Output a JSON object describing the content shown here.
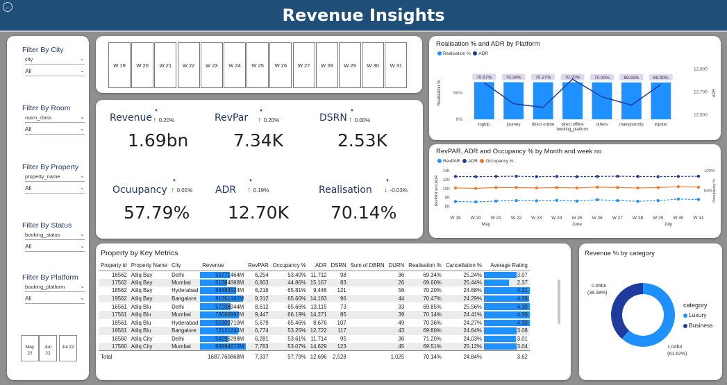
{
  "header": {
    "title": "Revenue Insights"
  },
  "filters": [
    {
      "title": "Filter By City",
      "field": "city",
      "value": "All"
    },
    {
      "title": "Filter By Room",
      "field": "room_class",
      "value": "All"
    },
    {
      "title": "Filter By Property",
      "field": "property_name",
      "value": "All"
    },
    {
      "title": "Filter By Status",
      "field": "booking_status",
      "value": "All"
    },
    {
      "title": "Filter By Platform",
      "field": "booking_platform",
      "value": "All"
    }
  ],
  "months": [
    {
      "line1": "May",
      "line2": "22"
    },
    {
      "line1": "Jun",
      "line2": "22"
    },
    {
      "line1": "Jul 22",
      "line2": ""
    }
  ],
  "weeks": [
    "W 19",
    "W 20",
    "W 21",
    "W 22",
    "W 23",
    "W 24",
    "W 25",
    "W 26",
    "W 27",
    "W 28",
    "W 29",
    "W 30",
    "W 31"
  ],
  "kpis": [
    {
      "name": "Revenue",
      "value": "1.69bn",
      "delta": "0.20%",
      "dir": "up"
    },
    {
      "name": "RevPar",
      "value": "7.34K",
      "delta": "0.20%",
      "dir": "up"
    },
    {
      "name": "DSRN",
      "value": "2.53K",
      "delta": "0.00%",
      "dir": "up"
    },
    {
      "name": "Ocuupancy",
      "value": "57.79%",
      "delta": "0.01%",
      "dir": "up"
    },
    {
      "name": "ADR",
      "value": "12.70K",
      "delta": "0.19%",
      "dir": "up"
    },
    {
      "name": "Realisation",
      "value": "70.14%",
      "delta": "-0.03%",
      "dir": "down"
    }
  ],
  "chart_data": [
    {
      "type": "bar",
      "title": "Realisation % and ADR by Platform",
      "categories": [
        "logtrip",
        "journey",
        "direct online",
        "direct offline",
        "others",
        "makeyourtrip",
        "tripster"
      ],
      "xlabel": "booking_platform",
      "ylabel": "Realisation %",
      "y2label": "ADR",
      "yticks": [
        "0%",
        "50%"
      ],
      "y2ticks": [
        "12,800",
        "12,700",
        "12,600"
      ],
      "series": [
        {
          "name": "Realisation %",
          "kind": "bar",
          "color": "#1e90ff",
          "values": [
            70.57,
            70.34,
            70.27,
            70.2,
            70.0,
            69.92,
            69.9
          ],
          "labels": [
            "70.57%",
            "70.34%",
            "70.27%",
            "70.20%",
            "70.00%",
            "69.92%",
            "69.90%"
          ]
        },
        {
          "name": "ADR",
          "kind": "line",
          "color": "#1f3c9c",
          "values": [
            12740,
            12648,
            12632,
            12755,
            12678,
            12642,
            12732
          ]
        }
      ],
      "ylim": [
        0,
        100
      ],
      "y2lim": [
        12580,
        12810
      ]
    },
    {
      "type": "line",
      "title": "RevPAR, ADR and Occupancy % by Month and week no",
      "x": [
        "W 19",
        "W 20",
        "W 21",
        "W 22",
        "W 23",
        "W 24",
        "W 25",
        "W 26",
        "W 27",
        "W 28",
        "W 29",
        "W 30",
        "W 31"
      ],
      "month_groups": [
        {
          "label": "May",
          "span": [
            0,
            3
          ]
        },
        {
          "label": "June",
          "span": [
            4,
            8
          ]
        },
        {
          "label": "July",
          "span": [
            9,
            12
          ]
        }
      ],
      "ylabel": "RevPAR and ADR",
      "y2label": "Occupancy %",
      "yticks": [
        "14K",
        "12K",
        "10K",
        "8K",
        "6K"
      ],
      "y2ticks": [
        "100%",
        "50%"
      ],
      "ylim": [
        5000,
        14000
      ],
      "y2lim": [
        0,
        100
      ],
      "series": [
        {
          "name": "RevPAR",
          "color": "#1e90ff",
          "dash": true,
          "axis": "y",
          "values": [
            7100,
            7000,
            7200,
            7300,
            7250,
            7350,
            7200,
            7500,
            7300,
            7150,
            7300,
            7650,
            7550
          ]
        },
        {
          "name": "ADR",
          "color": "#1f3c9c",
          "dash": true,
          "axis": "y",
          "values": [
            12700,
            12650,
            12700,
            12750,
            12650,
            12700,
            12650,
            12700,
            12750,
            12700,
            12650,
            12700,
            12750
          ]
        },
        {
          "name": "Occupancy %",
          "color": "#ed7d31",
          "dash": false,
          "axis": "y2",
          "values": [
            57,
            56,
            58,
            58,
            57,
            58,
            57,
            59,
            58,
            57,
            58,
            60,
            59
          ]
        }
      ]
    },
    {
      "type": "pie",
      "title": "Revenue % by category",
      "legend_title": "category",
      "categories": [
        "Luxury",
        "Business"
      ],
      "values": [
        1.04,
        0.65
      ],
      "labels": [
        "1.04bn (61.62%)",
        "0.65bn (38.38%)"
      ],
      "colors": [
        "#1e90ff",
        "#1f3c9c"
      ]
    }
  ],
  "table": {
    "title": "Property by Key Metrics",
    "columns": [
      "Property id",
      "Property Name",
      "City",
      "Revenue",
      "RevPAR",
      "Occupancy %",
      "ADR",
      "DSRN",
      "Sum of DBRN",
      "DURN",
      "Realisation %",
      "Cancellation %",
      "Average Rating"
    ],
    "rows": [
      [
        "16562",
        "Atliq Bay",
        "Delhi",
        "55771464M",
        "6,254",
        "53.40%",
        "11,712",
        "98",
        "",
        "36",
        "69.34%",
        "25.24%",
        "3.07"
      ],
      [
        "17562",
        "Atliq Bay",
        "Mumbai",
        "51384888M",
        "6,803",
        "44.86%",
        "15,167",
        "83",
        "",
        "26",
        "69.60%",
        "25.44%",
        "2.37"
      ],
      [
        "18562",
        "Atliq Bay",
        "Hyderabad",
        "68484524M",
        "6,216",
        "65.81%",
        "9,446",
        "121",
        "",
        "56",
        "70.20%",
        "24.68%",
        "4.31"
      ],
      [
        "19562",
        "Atliq Bay",
        "Bangalore",
        "81351382M",
        "9,312",
        "65.66%",
        "14,183",
        "96",
        "",
        "44",
        "70.47%",
        "24.29%",
        "4.28"
      ],
      [
        "16561",
        "Atliq Blu",
        "Delhi",
        "57206944M",
        "8,612",
        "65.66%",
        "13,115",
        "73",
        "",
        "33",
        "69.85%",
        "25.56%",
        "4.30"
      ],
      [
        "17561",
        "Atliq Blu",
        "Mumbai",
        "73066992M",
        "9,447",
        "66.19%",
        "14,271",
        "85",
        "",
        "39",
        "70.14%",
        "24.41%",
        "4.30"
      ],
      [
        "18561",
        "Atliq Blu",
        "Hyderabad",
        "55300710M",
        "5,679",
        "65.46%",
        "8,676",
        "107",
        "",
        "49",
        "70.36%",
        "24.27%",
        "4.30"
      ],
      [
        "19561",
        "Atliq Blu",
        "Bangalore",
        "72121244M",
        "6,774",
        "53.25%",
        "12,722",
        "117",
        "",
        "43",
        "69.80%",
        "24.64%",
        "3.08"
      ],
      [
        "16560",
        "Atliq City",
        "Delhi",
        "54296298M",
        "6,281",
        "53.61%",
        "11,714",
        "95",
        "",
        "36",
        "71.20%",
        "24.03%",
        "3.01"
      ],
      [
        "17560",
        "Atliq City",
        "Mumbai",
        "86894672M",
        "7,763",
        "53.07%",
        "14,629",
        "123",
        "",
        "45",
        "69.51%",
        "25.12%",
        "3.04"
      ]
    ],
    "revenue_fraction": [
      0.64,
      0.59,
      0.79,
      0.94,
      0.66,
      0.84,
      0.64,
      0.83,
      0.62,
      1.0
    ],
    "rating_fraction": [
      0.71,
      0.55,
      1.0,
      0.99,
      1.0,
      1.0,
      1.0,
      0.71,
      0.7,
      0.71
    ],
    "total": [
      "Total",
      "",
      "",
      "1687.760868M",
      "7,337",
      "57.79%",
      "12,696",
      "2,528",
      "",
      "1,025",
      "70.14%",
      "24.84%",
      "3.62"
    ]
  }
}
